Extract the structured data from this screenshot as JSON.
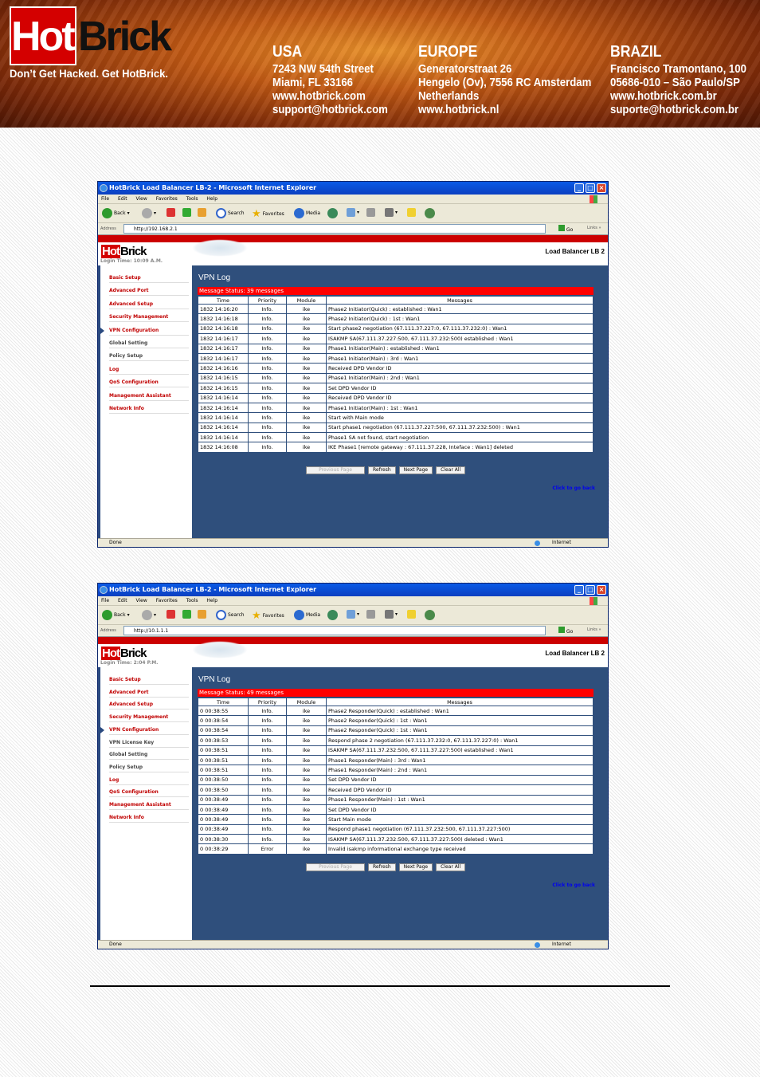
{
  "banner": {
    "logo_hot": "Hot",
    "logo_brick": "Brick",
    "slogan": "Don’t Get Hacked. Get HotBrick.",
    "usa": {
      "title": "USA",
      "lines": [
        "7243 NW 54th Street",
        "Miami, FL 33166",
        "www.hotbrick.com",
        "support@hotbrick.com"
      ]
    },
    "europe": {
      "title": "EUROPE",
      "lines": [
        "Generatorstraat 26",
        "Hengelo (Ov), 7556 RC Amsterdam",
        "Netherlands",
        "www.hotbrick.nl"
      ]
    },
    "brazil": {
      "title": "BRAZIL",
      "lines": [
        "Francisco Tramontano, 100",
        "05686-010 – São Paulo/SP",
        "www.hotbrick.com.br",
        "suporte@hotbrick.com.br"
      ]
    }
  },
  "browser": {
    "menu": [
      "File",
      "Edit",
      "View",
      "Favorites",
      "Tools",
      "Help"
    ],
    "toolbar": {
      "back": "Back",
      "search": "Search",
      "favorites": "Favorites",
      "media": "Media"
    },
    "address_label": "Address",
    "go": "Go",
    "links": "Links",
    "status_done": "Done",
    "status_zone": "Internet"
  },
  "windows": [
    {
      "title": "HotBrick Load Balancer LB-2 - Microsoft Internet Explorer",
      "url": "http://192.168.2.1",
      "logo_hot": "Hot",
      "logo_brick": "Brick",
      "login": "Login Time: 10:09 A.M.",
      "product": "Load Balancer LB 2",
      "nav": [
        "Basic Setup",
        "Advanced Port",
        "Advanced Setup",
        "Security Management",
        "VPN Configuration",
        "Global Setting",
        "Policy Setup",
        "Log",
        "QoS Configuration",
        "Management Assistant",
        "Network Info"
      ],
      "page_title": "VPN Log",
      "status": "Message Status: 39 messages",
      "headers": [
        "Time",
        "Priority",
        "Module",
        "Messages"
      ],
      "rows": [
        [
          "1832 14:16:20",
          "Info.",
          "ike",
          "Phase2 Initiator(Quick) : established : Wan1"
        ],
        [
          "1832 14:16:18",
          "Info.",
          "ike",
          "Phase2 Initiator(Quick) : 1st : Wan1"
        ],
        [
          "1832 14:16:18",
          "Info.",
          "ike",
          "Start phase2 negotiation (67.111.37.227:0, 67.111.37.232:0) : Wan1"
        ],
        [
          "1832 14:16:17",
          "Info.",
          "ike",
          "ISAKMP SA(67.111.37.227:500, 67.111.37.232:500) established : Wan1"
        ],
        [
          "1832 14:16:17",
          "Info.",
          "ike",
          "Phase1 Initiator(Main) : established : Wan1"
        ],
        [
          "1832 14:16:17",
          "Info.",
          "ike",
          "Phase1 Initiator(Main) : 3rd : Wan1"
        ],
        [
          "1832 14:16:16",
          "Info.",
          "ike",
          "Received DPD Vendor ID"
        ],
        [
          "1832 14:16:15",
          "Info.",
          "ike",
          "Phase1 Initiator(Main) : 2nd : Wan1"
        ],
        [
          "1832 14:16:15",
          "Info.",
          "ike",
          "Set DPD Vendor ID"
        ],
        [
          "1832 14:16:14",
          "Info.",
          "ike",
          "Received DPD Vendor ID"
        ],
        [
          "1832 14:16:14",
          "Info.",
          "ike",
          "Phase1 Initiator(Main) : 1st : Wan1"
        ],
        [
          "1832 14:16:14",
          "Info.",
          "ike",
          "Start with Main mode"
        ],
        [
          "1832 14:16:14",
          "Info.",
          "ike",
          "Start phase1 negotiation (67.111.37.227:500, 67.111.37.232:500) : Wan1"
        ],
        [
          "1832 14:16:14",
          "Info.",
          "ike",
          "Phase1 SA not found, start negotiation"
        ],
        [
          "1832 14:16:08",
          "Info.",
          "ike",
          "IKE Phase1 [remote gateway : 67.111.37.228, Inteface : Wan1] deleted"
        ]
      ],
      "buttons": [
        "Previous Page",
        "Refresh",
        "Next Page",
        "Clear All"
      ],
      "go_back": "Click to go back"
    },
    {
      "title": "HotBrick Load Balancer LB-2 - Microsoft Internet Explorer",
      "url": "http://10.1.1.1",
      "logo_hot": "Hot",
      "logo_brick": "Brick",
      "login": "Login Time: 2:04 P.M.",
      "product": "Load Balancer LB 2",
      "nav": [
        "Basic Setup",
        "Advanced Port",
        "Advanced Setup",
        "Security Management",
        "VPN Configuration",
        "VPN License Key",
        "Global Setting",
        "Policy Setup",
        "Log",
        "QoS Configuration",
        "Management Assistant",
        "Network Info"
      ],
      "page_title": "VPN Log",
      "status": "Message Status: 49 messages",
      "headers": [
        "Time",
        "Priority",
        "Module",
        "Messages"
      ],
      "rows": [
        [
          "0 00:38:55",
          "Info.",
          "ike",
          "Phase2 Responder(Quick) : established : Wan1"
        ],
        [
          "0 00:38:54",
          "Info.",
          "ike",
          "Phase2 Responder(Quick) : 1st : Wan1"
        ],
        [
          "0 00:38:54",
          "Info.",
          "ike",
          "Phase2 Responder(Quick) : 1st : Wan1"
        ],
        [
          "0 00:38:53",
          "Info.",
          "ike",
          "Respond phase 2 negotiation (67.111.37.232:0, 67.111.37.227:0) : Wan1"
        ],
        [
          "0 00:38:51",
          "Info.",
          "ike",
          "ISAKMP SA(67.111.37.232:500, 67.111.37.227:500) established : Wan1"
        ],
        [
          "0 00:38:51",
          "Info.",
          "ike",
          "Phase1 Responder(Main) : 3rd : Wan1"
        ],
        [
          "0 00:38:51",
          "Info.",
          "ike",
          "Phase1 Responder(Main) : 2nd : Wan1"
        ],
        [
          "0 00:38:50",
          "Info.",
          "ike",
          "Set DPD Vendor ID"
        ],
        [
          "0 00:38:50",
          "Info.",
          "ike",
          "Received DPD Vendor ID"
        ],
        [
          "0 00:38:49",
          "Info.",
          "ike",
          "Phase1 Responder(Main) : 1st : Wan1"
        ],
        [
          "0 00:38:49",
          "Info.",
          "ike",
          "Set DPD Vendor ID"
        ],
        [
          "0 00:38:49",
          "Info.",
          "ike",
          "Start Main mode"
        ],
        [
          "0 00:38:49",
          "Info.",
          "ike",
          "Respond phase1 negotiation (67.111.37.232:500, 67.111.37.227:500)"
        ],
        [
          "0 00:38:30",
          "Info.",
          "ike",
          "ISAKMP SA(67.111.37.232:500, 67.111.37.227:500) deleted : Wan1"
        ],
        [
          "0 00:38:29",
          "Error",
          "ike",
          "Invalid isakmp informational exchange type received"
        ]
      ],
      "buttons": [
        "Previous Page",
        "Refresh",
        "Next Page",
        "Clear All"
      ],
      "go_back": "Click to go back"
    }
  ]
}
